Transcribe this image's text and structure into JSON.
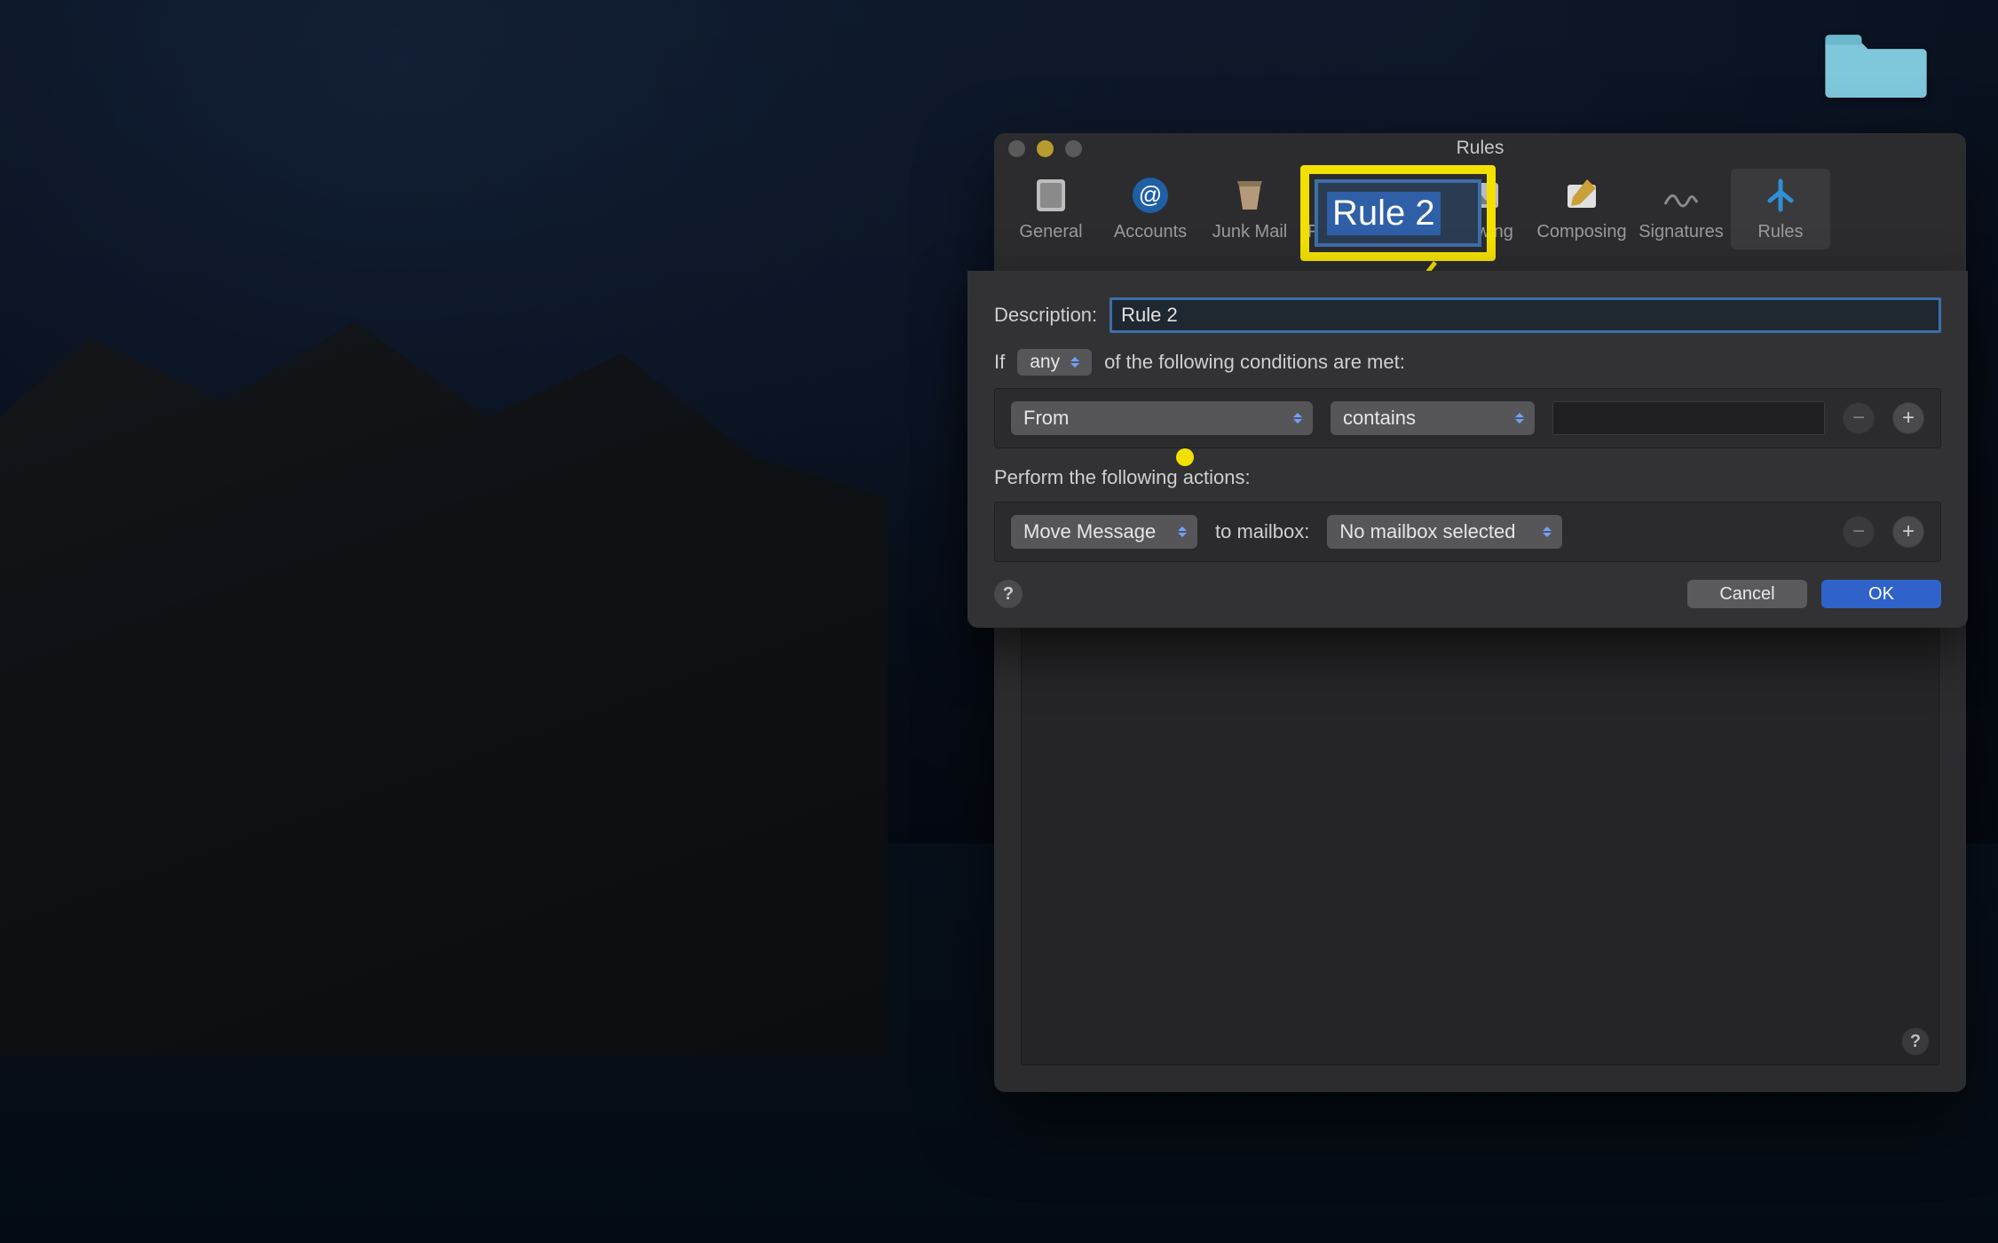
{
  "desktop": {
    "folder_label": ""
  },
  "prefs": {
    "window_title": "Rules",
    "tabs": [
      {
        "label": "General"
      },
      {
        "label": "Accounts"
      },
      {
        "label": "Junk Mail"
      },
      {
        "label": "Fonts & Colors"
      },
      {
        "label": "Viewing"
      },
      {
        "label": "Composing"
      },
      {
        "label": "Signatures"
      },
      {
        "label": "Rules"
      }
    ],
    "selected_tab": "Rules"
  },
  "sheet": {
    "description_label": "Description:",
    "description_value": "Rule 2",
    "if_label": "If",
    "if_quantifier": "any",
    "if_suffix": "of the following conditions are met:",
    "condition": {
      "field": "From",
      "operator": "contains",
      "value": ""
    },
    "actions_label": "Perform the following actions:",
    "action": {
      "verb": "Move Message",
      "to_label": "to mailbox:",
      "mailbox": "No mailbox selected"
    },
    "buttons": {
      "cancel": "Cancel",
      "ok": "OK"
    }
  },
  "callout": {
    "highlight_text": "Rule 2"
  }
}
